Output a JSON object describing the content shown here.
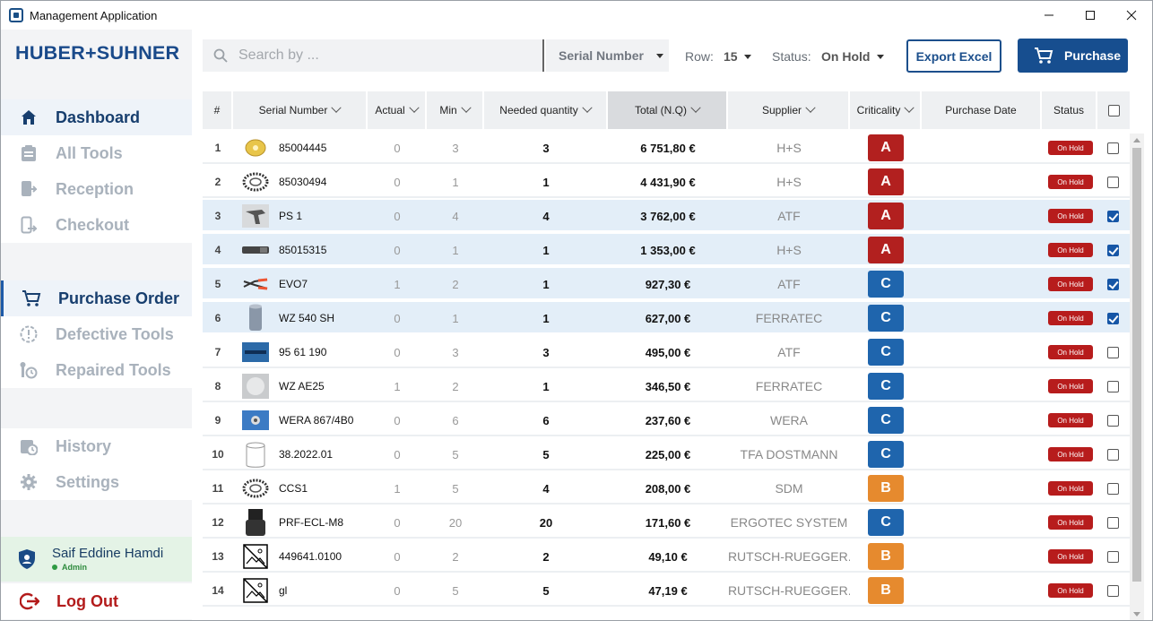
{
  "window": {
    "title": "Management Application"
  },
  "sidebar": {
    "logo": "HUBER+SUHNER",
    "groups": [
      {
        "items": [
          {
            "label": "Dashboard",
            "icon": "home-icon"
          },
          {
            "label": "All Tools",
            "icon": "clipboard-icon"
          },
          {
            "label": "Reception",
            "icon": "reception-icon"
          },
          {
            "label": "Checkout",
            "icon": "checkout-icon"
          }
        ]
      },
      {
        "items": [
          {
            "label": "Purchase Order",
            "icon": "cart-icon"
          },
          {
            "label": "Defective Tools",
            "icon": "alert-circle-icon"
          },
          {
            "label": "Repaired Tools",
            "icon": "wrench-icon"
          }
        ]
      },
      {
        "items": [
          {
            "label": "History",
            "icon": "history-icon"
          },
          {
            "label": "Settings",
            "icon": "gear-icon"
          }
        ]
      }
    ],
    "user": {
      "name": "Saif Eddine Hamdi",
      "role": "Admin"
    },
    "logout": "Log Out"
  },
  "toolbar": {
    "search_placeholder": "Search by ...",
    "search_by": "Serial Number",
    "row_label": "Row:",
    "row_value": "15",
    "status_label": "Status:",
    "status_value": "On Hold",
    "export_label": "Export Excel",
    "purchase_label": "Purchase"
  },
  "table": {
    "headers": {
      "idx": "#",
      "serial": "Serial Number",
      "actual": "Actual",
      "min": "Min",
      "needed": "Needed quantity",
      "total": "Total (N.Q)",
      "supplier": "Supplier",
      "criticality": "Criticality",
      "purchase_date": "Purchase Date",
      "status": "Status"
    },
    "rows": [
      {
        "idx": "1",
        "serial": "85004445",
        "actual": "0",
        "min": "3",
        "needed": "3",
        "total": "6 751,80 €",
        "supplier": "H+S",
        "crit": "A",
        "date": "",
        "status": "On Hold",
        "checked": false,
        "thumb": "gold-disc"
      },
      {
        "idx": "2",
        "serial": "85030494",
        "actual": "0",
        "min": "1",
        "needed": "1",
        "total": "4 431,90 €",
        "supplier": "H+S",
        "crit": "A",
        "date": "",
        "status": "On Hold",
        "checked": false,
        "thumb": "ring"
      },
      {
        "idx": "3",
        "serial": "PS 1",
        "actual": "0",
        "min": "4",
        "needed": "4",
        "total": "3 762,00 €",
        "supplier": "ATF",
        "crit": "A",
        "date": "",
        "status": "On Hold",
        "checked": true,
        "thumb": "tool-grey"
      },
      {
        "idx": "4",
        "serial": "85015315",
        "actual": "0",
        "min": "1",
        "needed": "1",
        "total": "1 353,00 €",
        "supplier": "H+S",
        "crit": "A",
        "date": "",
        "status": "On Hold",
        "checked": true,
        "thumb": "bar"
      },
      {
        "idx": "5",
        "serial": "EVO7",
        "actual": "1",
        "min": "2",
        "needed": "1",
        "total": "927,30 €",
        "supplier": "ATF",
        "crit": "C",
        "date": "",
        "status": "On Hold",
        "checked": true,
        "thumb": "pliers"
      },
      {
        "idx": "6",
        "serial": "WZ 540 SH",
        "actual": "0",
        "min": "1",
        "needed": "1",
        "total": "627,00 €",
        "supplier": "FERRATEC",
        "crit": "C",
        "date": "",
        "status": "On Hold",
        "checked": true,
        "thumb": "cylinder"
      },
      {
        "idx": "7",
        "serial": "95 61 190",
        "actual": "0",
        "min": "3",
        "needed": "3",
        "total": "495,00 €",
        "supplier": "ATF",
        "crit": "C",
        "date": "",
        "status": "On Hold",
        "checked": false,
        "thumb": "blue"
      },
      {
        "idx": "8",
        "serial": "WZ AE25",
        "actual": "1",
        "min": "2",
        "needed": "1",
        "total": "346,50 €",
        "supplier": "FERRATEC",
        "crit": "C",
        "date": "",
        "status": "On Hold",
        "checked": false,
        "thumb": "grey-block"
      },
      {
        "idx": "9",
        "serial": "WERA 867/4B0",
        "actual": "0",
        "min": "6",
        "needed": "6",
        "total": "237,60 €",
        "supplier": "WERA",
        "crit": "C",
        "date": "",
        "status": "On Hold",
        "checked": false,
        "thumb": "blue-star"
      },
      {
        "idx": "10",
        "serial": "38.2022.01",
        "actual": "0",
        "min": "5",
        "needed": "5",
        "total": "225,00 €",
        "supplier": "TFA DOSTMANN",
        "crit": "C",
        "date": "",
        "status": "On Hold",
        "checked": false,
        "thumb": "outline"
      },
      {
        "idx": "11",
        "serial": "CCS1",
        "actual": "1",
        "min": "5",
        "needed": "4",
        "total": "208,00 €",
        "supplier": "SDM",
        "crit": "B",
        "date": "",
        "status": "On Hold",
        "checked": false,
        "thumb": "ring"
      },
      {
        "idx": "12",
        "serial": "PRF-ECL-M8",
        "actual": "0",
        "min": "20",
        "needed": "20",
        "total": "171,60 €",
        "supplier": "ERGOTEC SYSTEM",
        "crit": "C",
        "date": "",
        "status": "On Hold",
        "checked": false,
        "thumb": "dark"
      },
      {
        "idx": "13",
        "serial": "449641.0100",
        "actual": "0",
        "min": "2",
        "needed": "2",
        "total": "49,10 €",
        "supplier": "BRUTSCH-RUEGGER...",
        "crit": "B",
        "date": "",
        "status": "On Hold",
        "checked": false,
        "thumb": "no-image"
      },
      {
        "idx": "14",
        "serial": "gl",
        "actual": "0",
        "min": "5",
        "needed": "5",
        "total": "47,19 €",
        "supplier": "BRUTSCH-RUEGGER...",
        "crit": "B",
        "date": "",
        "status": "On Hold",
        "checked": false,
        "thumb": "no-image"
      }
    ]
  },
  "colors": {
    "crit_A": "#b2201f",
    "crit_B": "#e68a2e",
    "crit_C": "#1f65ad",
    "brand": "#1a4a8a",
    "status_on_hold": "#b71c1c"
  }
}
